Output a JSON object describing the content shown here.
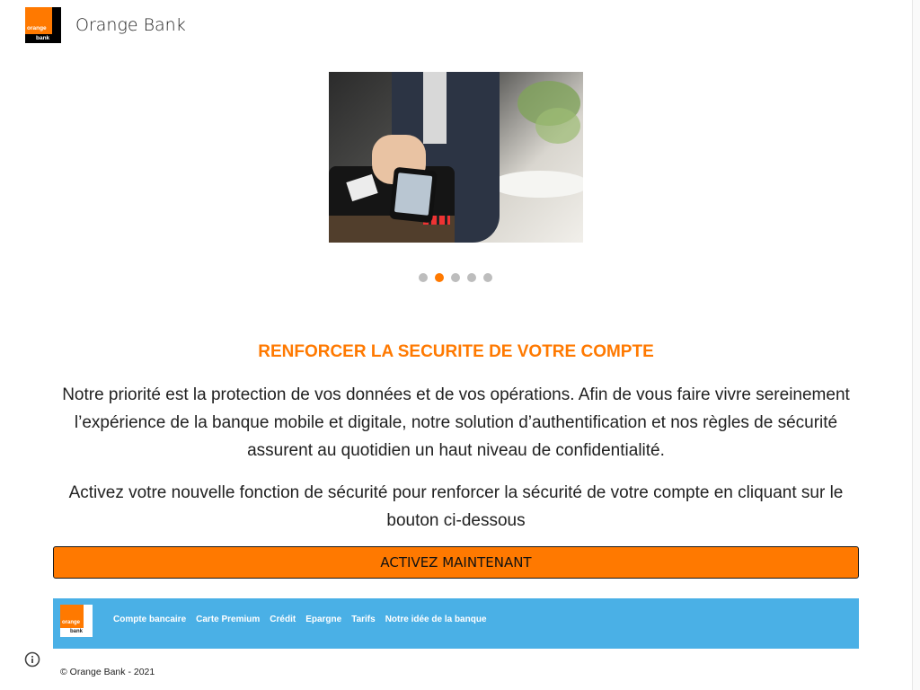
{
  "header": {
    "logo": {
      "line1": "orange",
      "line2": "bank",
      "brand_color": "#ff7900"
    },
    "title": "Orange Bank"
  },
  "carousel": {
    "image_alt": "Paiement sans contact avec smartphone",
    "dot_count": 5,
    "active_index": 1
  },
  "main": {
    "heading": "RENFORCER LA SECURITE DE VOTRE COMPTE",
    "paragraph1": "Notre priorité est la protection de vos données et de vos opérations. Afin de vous faire vivre sereinement l’expérience de la banque mobile et digitale, notre solution d’authentification et nos règles de sécurité assurent au quotidien un haut niveau de confidentialité.",
    "paragraph2": "Activez votre nouvelle fonction de sécurité pour renforcer la sécurité de votre compte en cliquant sur le bouton ci-dessous",
    "cta_label": "ACTIVEZ MAINTENANT"
  },
  "nav_band": {
    "logo": {
      "line1": "orange",
      "line2": "bank"
    },
    "links": [
      "Compte bancaire",
      "Carte Premium",
      "Crédit",
      "Epargne",
      "Tarifs",
      "Notre idée de la banque"
    ],
    "background_color": "#4ab0e6"
  },
  "footer": {
    "copyright": "© Orange Bank - 2021",
    "info_icon": "info-icon"
  },
  "colors": {
    "accent": "#ff7900",
    "text": "#212121"
  }
}
